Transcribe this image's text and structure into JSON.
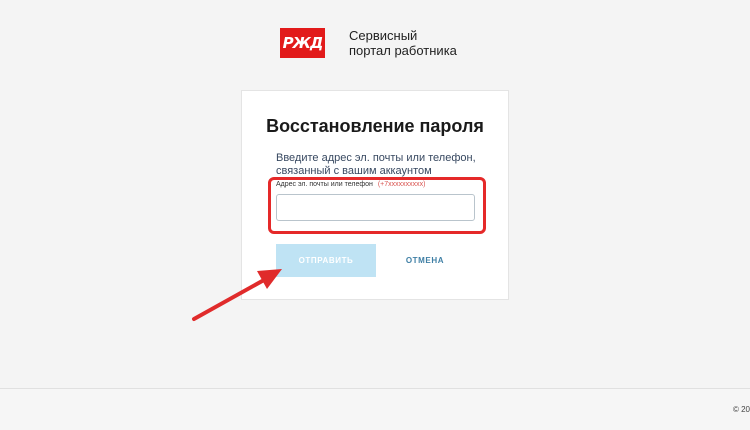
{
  "brand": {
    "logo_text": "РЖД",
    "name": "Сервисный\nпортал работника"
  },
  "form": {
    "title": "Восстановление пароля",
    "description": "Введите адрес эл. почты или телефон, связанный с вашим аккаунтом",
    "field_label": "Адрес эл. почты или телефон",
    "field_hint": "(+7xxxxxxxxxx)",
    "field_value": "",
    "submit_label": "ОТПРАВИТЬ",
    "cancel_label": "ОТМЕНА"
  },
  "footer": {
    "copyright": "© 20"
  },
  "colors": {
    "brand_red": "#e21a1a",
    "highlight": "#e52929",
    "submit_disabled": "#bfe3f4",
    "cancel_text": "#3f7fa5"
  }
}
